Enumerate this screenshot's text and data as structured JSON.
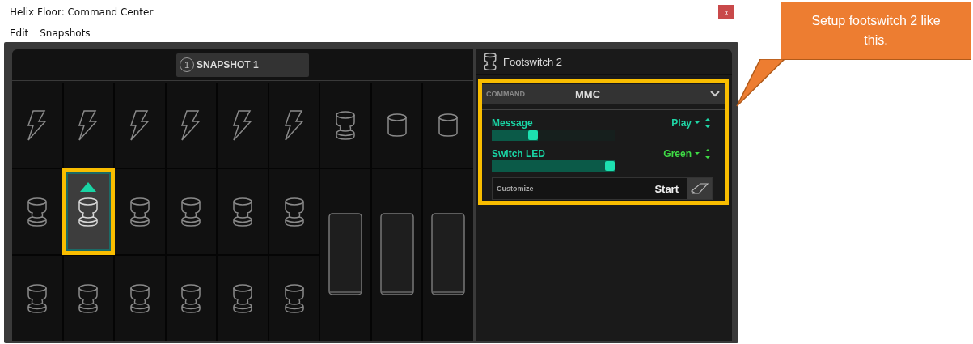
{
  "window": {
    "title": "Helix Floor: Command Center",
    "close": "x"
  },
  "menu": [
    {
      "label": "Edit"
    },
    {
      "label": "Snapshots"
    }
  ],
  "snapshot": {
    "number": "1",
    "label": "SNAPSHOT 1"
  },
  "cells": [
    {
      "kind": "bolt",
      "selected": false
    },
    {
      "kind": "bolt",
      "selected": false
    },
    {
      "kind": "bolt",
      "selected": false
    },
    {
      "kind": "bolt",
      "selected": false
    },
    {
      "kind": "bolt",
      "selected": false
    },
    {
      "kind": "bolt",
      "selected": false
    },
    {
      "kind": "switch",
      "selected": false
    },
    {
      "kind": "knob",
      "selected": false
    },
    {
      "kind": "knob",
      "selected": false
    },
    {
      "kind": "switch",
      "selected": false
    },
    {
      "kind": "switch",
      "selected": true
    },
    {
      "kind": "switch",
      "selected": false
    },
    {
      "kind": "switch",
      "selected": false
    },
    {
      "kind": "switch",
      "selected": false
    },
    {
      "kind": "switch",
      "selected": false
    },
    {
      "kind": "pedal",
      "selected": false
    },
    {
      "kind": "pedal",
      "selected": false
    },
    {
      "kind": "pedal",
      "selected": false
    },
    {
      "kind": "switch",
      "selected": false
    },
    {
      "kind": "switch",
      "selected": false
    },
    {
      "kind": "switch",
      "selected": false
    },
    {
      "kind": "switch",
      "selected": false
    },
    {
      "kind": "switch",
      "selected": false
    },
    {
      "kind": "switch",
      "selected": false
    }
  ],
  "inspector": {
    "title": "Footswitch 2",
    "command_label": "COMMAND",
    "command": "MMC",
    "params": [
      {
        "label": "Message",
        "value": "Play",
        "color": "#1fd6a6",
        "level": 0.32
      },
      {
        "label": "Switch LED",
        "value": "Green",
        "color": "#3fdc45",
        "level": 1.0
      }
    ],
    "customize": {
      "label": "Customize",
      "value": "Start"
    }
  },
  "callout": {
    "text": "Setup footswitch 2 like this."
  }
}
